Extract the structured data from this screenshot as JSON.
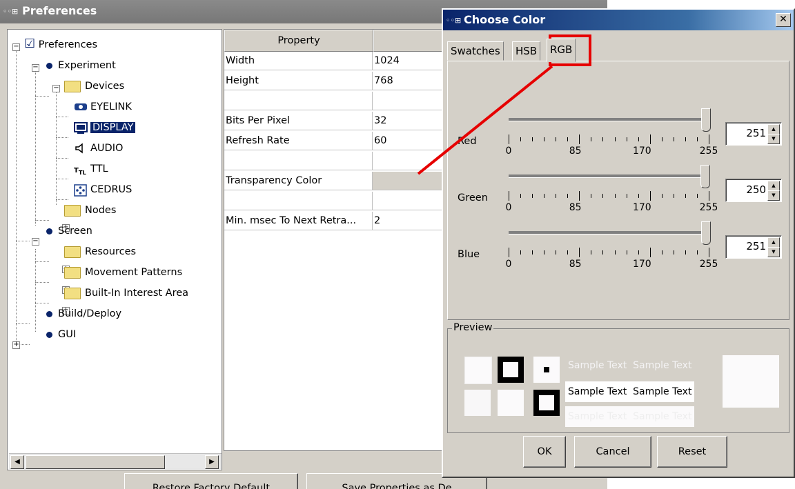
{
  "preferences": {
    "title": "Preferences",
    "tree": {
      "root": "Preferences",
      "experiment": "Experiment",
      "devices": "Devices",
      "device_items": [
        "EYELINK",
        "DISPLAY",
        "AUDIO",
        "TTL",
        "CEDRUS"
      ],
      "nodes": "Nodes",
      "screen": "Screen",
      "screen_items": [
        "Resources",
        "Movement Patterns",
        "Built-In Interest Area"
      ],
      "build_deploy": "Build/Deploy",
      "gui": "GUI"
    },
    "table": {
      "header_property": "Property",
      "rows": [
        {
          "property": "Width",
          "value": "1024"
        },
        {
          "property": "Height",
          "value": "768"
        },
        {
          "property": "",
          "value": ""
        },
        {
          "property": "Bits Per Pixel",
          "value": "32"
        },
        {
          "property": "Refresh Rate",
          "value": "60"
        },
        {
          "property": "",
          "value": ""
        },
        {
          "property": "Transparency Color",
          "value": ""
        },
        {
          "property": "",
          "value": ""
        },
        {
          "property": "Min. msec To Next Retra...",
          "value": "2"
        }
      ]
    },
    "buttons": {
      "restore": "Restore Factory Default",
      "save": "Save Properties as De"
    }
  },
  "choose_color": {
    "title": "Choose Color",
    "close": "✕",
    "tabs": [
      "Swatches",
      "HSB",
      "RGB"
    ],
    "active_tab": "RGB",
    "sliders": [
      {
        "label": "Red",
        "value": "251"
      },
      {
        "label": "Green",
        "value": "250"
      },
      {
        "label": "Blue",
        "value": "251"
      }
    ],
    "tick_labels": [
      "0",
      "85",
      "170",
      "255"
    ],
    "preview_label": "Preview",
    "sample_text": "Sample Text",
    "buttons": {
      "ok": "OK",
      "cancel": "Cancel",
      "reset": "Reset"
    },
    "selected_color": "#fbfafb",
    "highlight_color": "#e60000"
  }
}
